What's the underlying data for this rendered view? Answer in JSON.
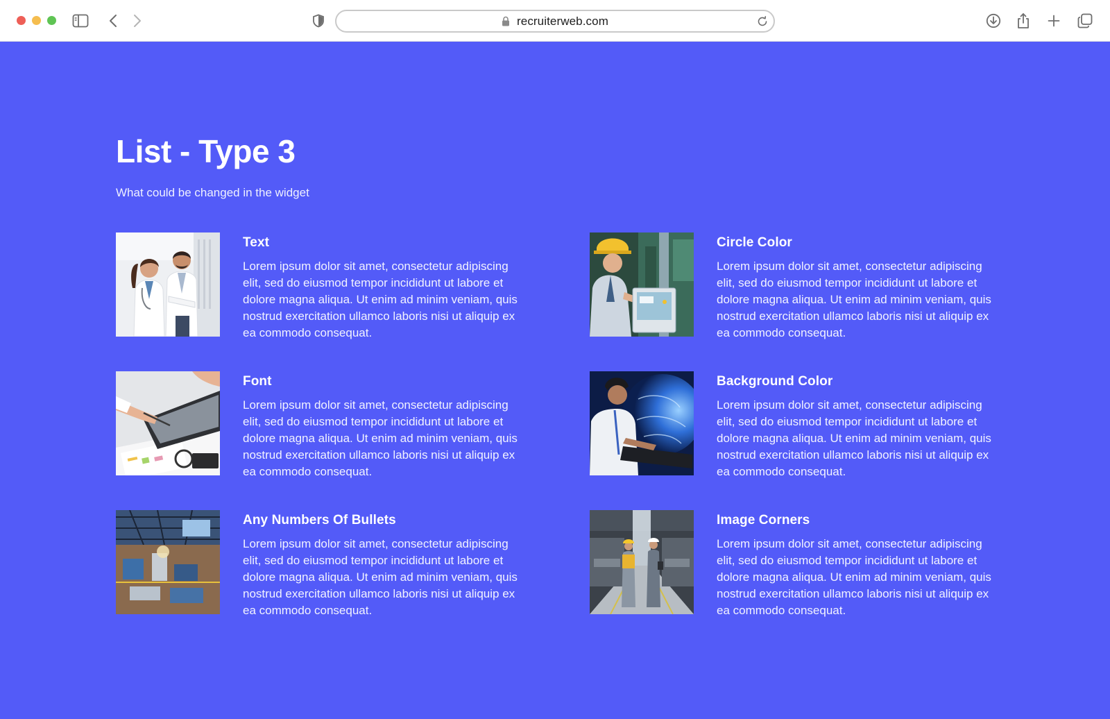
{
  "browser": {
    "url": "recruiterweb.com",
    "icons": {
      "sidebar": "sidebar-icon",
      "back": "chevron-left-icon",
      "forward": "chevron-right-icon",
      "privacy": "shield-icon",
      "lock": "lock-icon",
      "reload": "reload-icon",
      "download": "download-icon",
      "share": "share-icon",
      "new_tab": "plus-icon",
      "tabs": "tabs-overview-icon"
    }
  },
  "colors": {
    "page_background": "#535bf8",
    "text": "#ffffff"
  },
  "page": {
    "title": "List - Type 3",
    "subtitle": "What could be changed in the widget",
    "items": [
      {
        "title": "Text",
        "text": "Lorem ipsum dolor sit amet, consectetur adipiscing elit, sed do eiusmod tempor incididunt ut labore et dolore magna aliqua. Ut enim ad minim veniam, quis nostrud exercitation ullamco laboris nisi ut aliquip ex ea commodo consequat.",
        "image": "doctors-photo"
      },
      {
        "title": "Circle Color",
        "text": "Lorem ipsum dolor sit amet, consectetur adipiscing elit, sed do eiusmod tempor incididunt ut labore et dolore magna aliqua. Ut enim ad minim veniam, quis nostrud exercitation ullamco laboris nisi ut aliquip ex ea commodo consequat.",
        "image": "engineer-control-panel-photo"
      },
      {
        "title": "Font",
        "text": "Lorem ipsum dolor sit amet, consectetur adipiscing elit, sed do eiusmod tempor incididunt ut labore et dolore magna aliqua. Ut enim ad minim veniam, quis nostrud exercitation ullamco laboris nisi ut aliquip ex ea commodo consequat.",
        "image": "tablet-documents-photo"
      },
      {
        "title": "Background Color",
        "text": "Lorem ipsum dolor sit amet, consectetur adipiscing elit, sed do eiusmod tempor incididunt ut labore et dolore magna aliqua. Ut enim ad minim veniam, quis nostrud exercitation ullamco laboris nisi ut aliquip ex ea commodo consequat.",
        "image": "scientist-laptop-photo"
      },
      {
        "title": "Any Numbers Of Bullets",
        "text": "Lorem ipsum dolor sit amet, consectetur adipiscing elit, sed do eiusmod tempor incididunt ut labore et dolore magna aliqua. Ut enim ad minim veniam, quis nostrud exercitation ullamco laboris nisi ut aliquip ex ea commodo consequat.",
        "image": "factory-hall-photo"
      },
      {
        "title": "Image Corners",
        "text": "Lorem ipsum dolor sit amet, consectetur adipiscing elit, sed do eiusmod tempor incididunt ut labore et dolore magna aliqua. Ut enim ad minim veniam, quis nostrud exercitation ullamco laboris nisi ut aliquip ex ea commodo consequat.",
        "image": "workers-warehouse-photo"
      }
    ]
  }
}
